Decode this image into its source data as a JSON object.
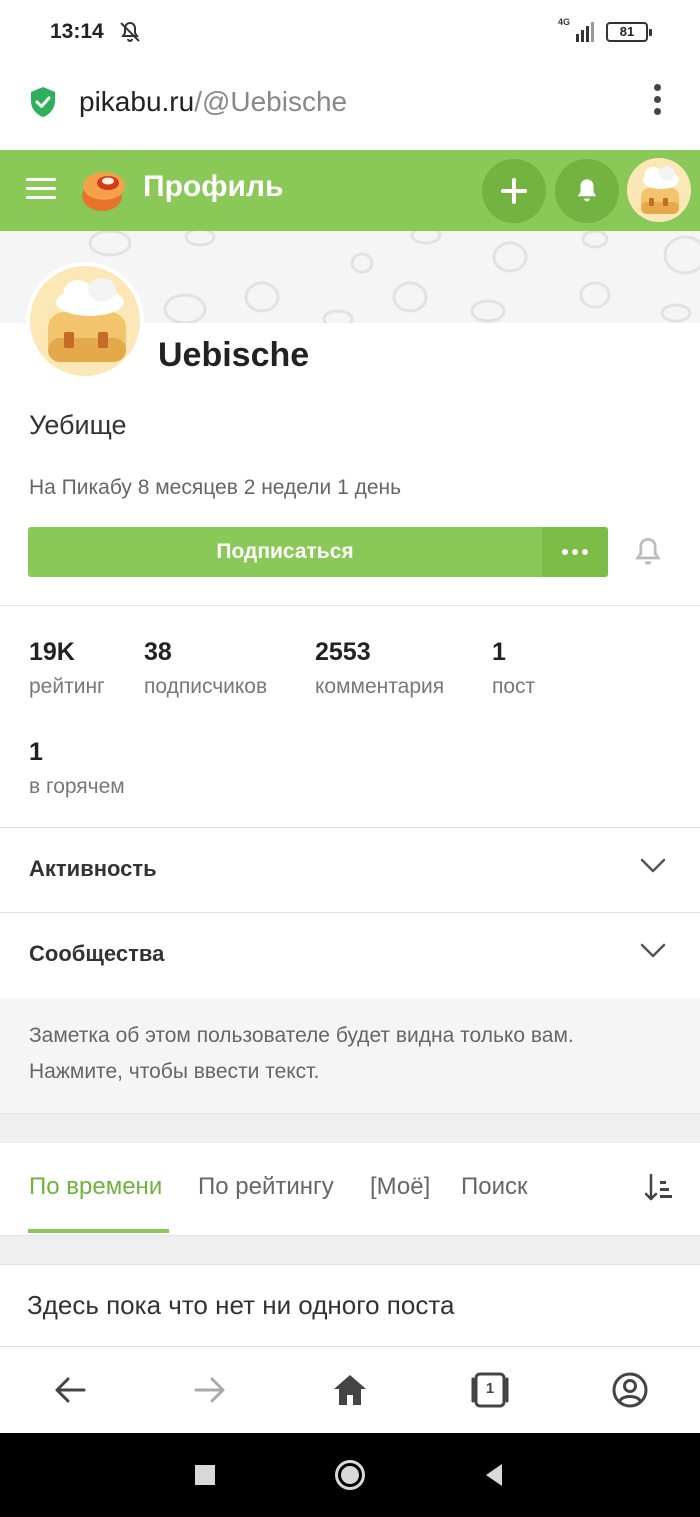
{
  "status_bar": {
    "time": "13:14",
    "network": "4G",
    "battery": "81"
  },
  "url_bar": {
    "domain": "pikabu.ru",
    "path": "/@Uebische"
  },
  "header": {
    "title": "Профиль"
  },
  "profile": {
    "username": "Uebische",
    "display_name": "Уебище",
    "member_since": "На Пикабу 8 месяцев 2 недели 1 день",
    "subscribe_label": "Подписаться",
    "stats": [
      {
        "value": "19K",
        "label": "рейтинг"
      },
      {
        "value": "38",
        "label": "подписчиков"
      },
      {
        "value": "2553",
        "label": "комментария"
      },
      {
        "value": "1",
        "label": "пост"
      },
      {
        "value": "1",
        "label": "в горячем"
      }
    ]
  },
  "sections": {
    "activity": "Активность",
    "communities": "Сообщества"
  },
  "note": {
    "text": "Заметка об этом пользователе будет видна только вам. Нажмите, чтобы ввести текст."
  },
  "tabs": [
    {
      "label": "По времени",
      "active": true
    },
    {
      "label": "По рейтингу",
      "active": false
    },
    {
      "label": "[Моё]",
      "active": false
    },
    {
      "label": "Поиск",
      "active": false
    }
  ],
  "empty_message": "Здесь пока что нет ни одного поста",
  "browser_nav": {
    "tab_count": "1"
  },
  "colors": {
    "brand_green": "#8ac858",
    "active_tab": "#6fb23d"
  },
  "icons": [
    "bell-off-icon",
    "signal-icon",
    "battery-icon",
    "shield-check-icon",
    "more-vert-icon",
    "hamburger-icon",
    "pikabu-logo",
    "plus-icon",
    "bell-icon",
    "chevron-down-icon",
    "sort-icon",
    "back-icon",
    "forward-icon",
    "home-icon",
    "tabs-icon",
    "account-icon"
  ]
}
